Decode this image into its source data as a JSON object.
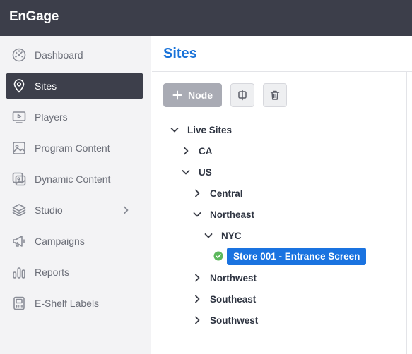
{
  "app": {
    "brand": "EnGage"
  },
  "sidebar": {
    "items": [
      {
        "label": "Dashboard",
        "icon": "dashboard-icon",
        "active": false
      },
      {
        "label": "Sites",
        "icon": "location-pin-icon",
        "active": true
      },
      {
        "label": "Players",
        "icon": "player-icon",
        "active": false
      },
      {
        "label": "Program Content",
        "icon": "image-icon",
        "active": false
      },
      {
        "label": "Dynamic Content",
        "icon": "dynamic-image-icon",
        "active": false
      },
      {
        "label": "Studio",
        "icon": "layers-icon",
        "active": false,
        "expandable": true
      },
      {
        "label": "Campaigns",
        "icon": "megaphone-icon",
        "active": false
      },
      {
        "label": "Reports",
        "icon": "bar-chart-icon",
        "active": false
      },
      {
        "label": "E-Shelf Labels",
        "icon": "shelf-label-icon",
        "active": false
      }
    ]
  },
  "main": {
    "title": "Sites",
    "toolbar": {
      "add_node_label": "Node",
      "split_icon": "split-icon",
      "delete_icon": "trash-icon"
    }
  },
  "tree": {
    "live_sites": "Live Sites",
    "ca": "CA",
    "us": "US",
    "central": "Central",
    "northeast": "Northeast",
    "nyc": "NYC",
    "store": "Store 001 - Entrance Screen",
    "northwest": "Northwest",
    "southeast": "Southeast",
    "southwest": "Southwest"
  },
  "colors": {
    "topbar": "#3c3e4a",
    "accent": "#1a73e0",
    "status_ok": "#5cb85c"
  }
}
